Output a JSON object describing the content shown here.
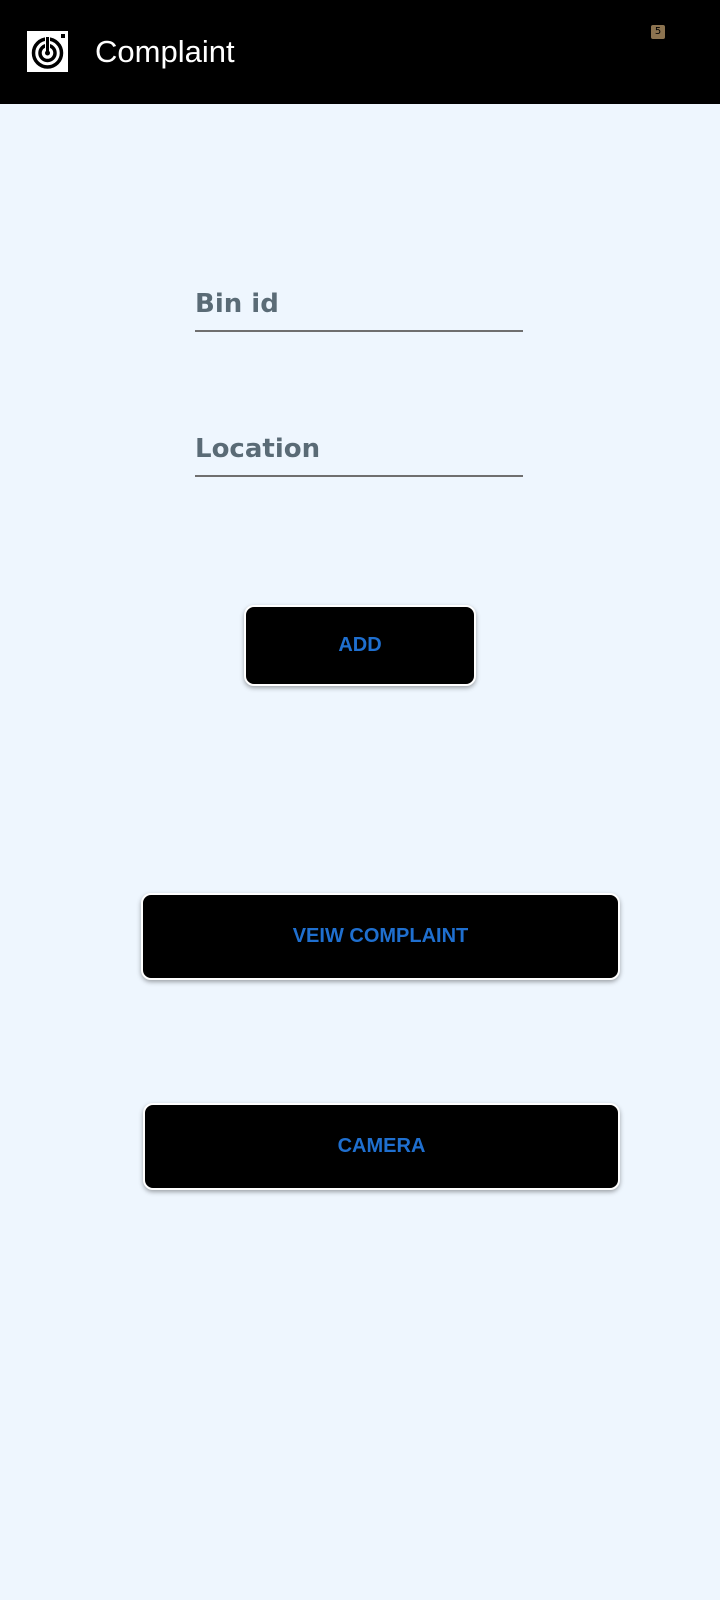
{
  "app_bar": {
    "title": "Complaint",
    "logo_icon": "target-drop-logo-icon",
    "badge_text": "5",
    "background": "#000000"
  },
  "form": {
    "bin_id": {
      "placeholder": "Bin id",
      "value": ""
    },
    "location": {
      "placeholder": "Location",
      "value": ""
    },
    "add_label": "ADD"
  },
  "actions": {
    "view_label": "VEIW COMPLAINT",
    "camera_label": "CAMERA"
  },
  "colors": {
    "page_background": "#eef6fe",
    "button_background": "#000000",
    "button_text": "#1f6fcf",
    "hint_text": "#5a6b76"
  }
}
